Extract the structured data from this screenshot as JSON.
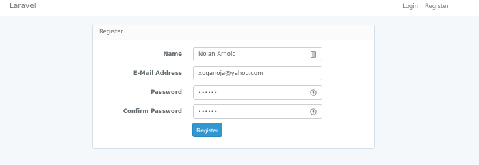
{
  "navbar": {
    "brand": "Laravel",
    "links": [
      "Login",
      "Register"
    ]
  },
  "panel": {
    "title": "Register"
  },
  "form": {
    "fields": [
      {
        "label": "Name",
        "value": "Nolan Arnold",
        "icon": "contact-card-icon"
      },
      {
        "label": "E-Mail Address",
        "value": "xuqanoja@yahoo.com",
        "icon": ""
      },
      {
        "label": "Password",
        "value": "••••••",
        "icon": "password-manager-icon"
      },
      {
        "label": "Confirm Password",
        "value": "••••••",
        "icon": "password-manager-icon"
      }
    ],
    "submit_label": "Register"
  },
  "colors": {
    "primary": "#3097d1",
    "background": "#f5f8fa",
    "border": "#d3e0e9"
  }
}
